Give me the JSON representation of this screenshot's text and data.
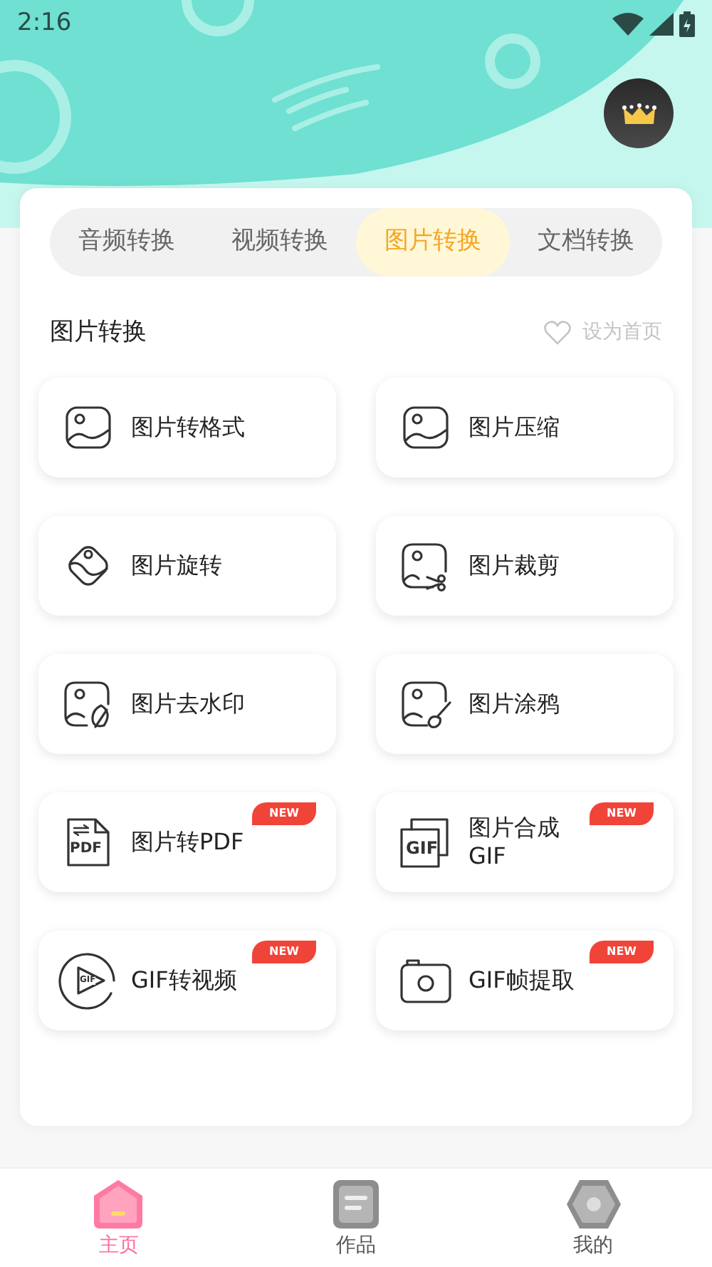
{
  "status_bar": {
    "time": "2:16"
  },
  "tabs": [
    {
      "label": "音频转换",
      "selected": false
    },
    {
      "label": "视频转换",
      "selected": false
    },
    {
      "label": "图片转换",
      "selected": true
    },
    {
      "label": "文档转换",
      "selected": false
    }
  ],
  "section": {
    "title": "图片转换",
    "favorite": {
      "label": "设为首页",
      "on": false
    }
  },
  "tools": [
    {
      "label": "图片转格式",
      "kind": "image"
    },
    {
      "label": "图片压缩",
      "kind": "image"
    },
    {
      "label": "图片旋转",
      "kind": "rotate"
    },
    {
      "label": "图片裁剪",
      "kind": "crop"
    },
    {
      "label": "图片去水印",
      "kind": "watermark"
    },
    {
      "label": "图片涂鸦",
      "kind": "brush"
    },
    {
      "label": "图片转PDF",
      "kind": "pdf",
      "icon_text": "PDF",
      "badge": "NEW"
    },
    {
      "label": "图片合成GIF",
      "kind": "gif",
      "icon_text": "GIF",
      "badge": "NEW"
    },
    {
      "label": "GIF转视频",
      "kind": "video",
      "icon_text": "GIF",
      "badge": "NEW"
    },
    {
      "label": "GIF帧提取",
      "kind": "camera",
      "badge": "NEW"
    }
  ],
  "bottom_nav": [
    {
      "label": "主页",
      "kind": "home",
      "selected": true
    },
    {
      "label": "作品",
      "kind": "works",
      "selected": false
    },
    {
      "label": "我的",
      "kind": "me",
      "selected": false
    }
  ]
}
